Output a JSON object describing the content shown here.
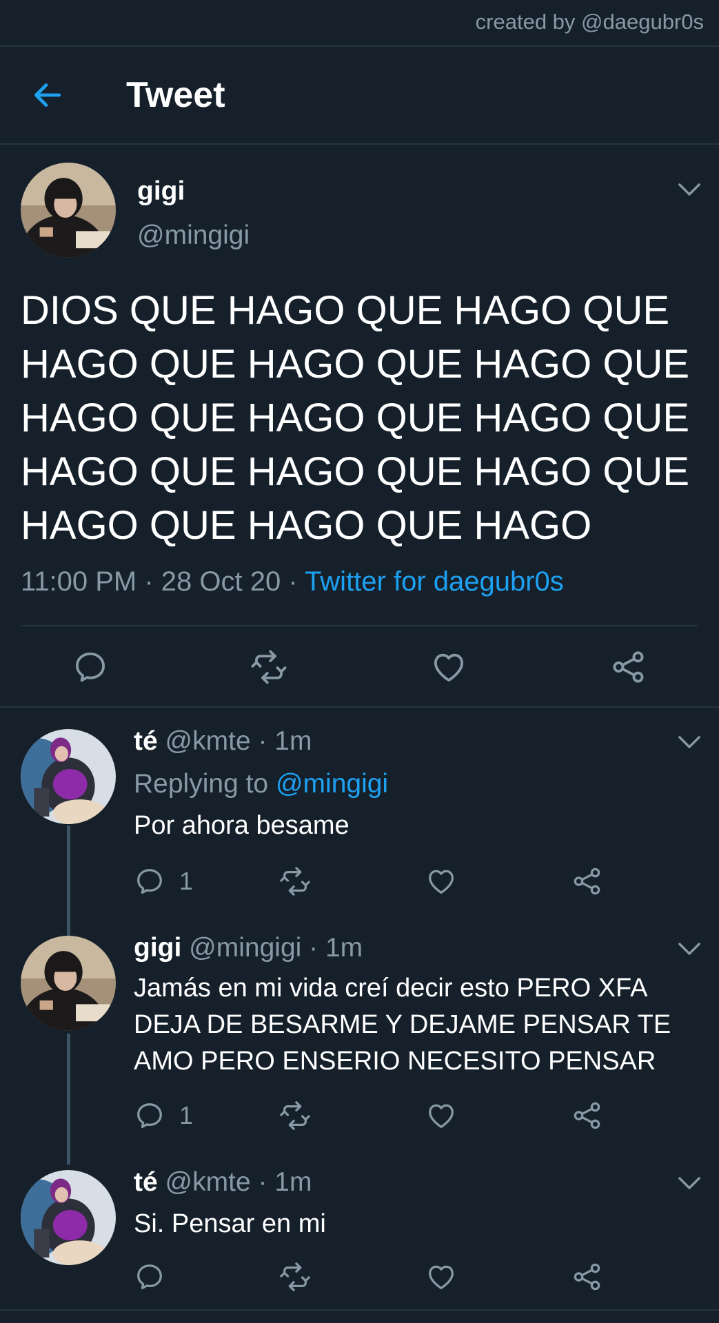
{
  "credit": "created by @daegubr0s",
  "header": {
    "title": "Tweet"
  },
  "main_tweet": {
    "name": "gigi",
    "handle": "@mingigi",
    "text": "DIOS QUE HAGO QUE HAGO QUE HAGO QUE HAGO QUE HAGO QUE HAGO QUE HAGO QUE HAGO QUE HAGO QUE HAGO QUE HAGO QUE HAGO QUE HAGO QUE HAGO",
    "time": "11:00 PM · 28 Oct 20 · ",
    "source": "Twitter for daegubr0s"
  },
  "replies": [
    {
      "name": "té",
      "handle": "@kmte · 1m",
      "replying_prefix": "Replying to ",
      "replying_to": "@mingigi",
      "text": "Por ahora besame",
      "reply_count": "1"
    },
    {
      "name": "gigi",
      "handle": "@mingigi · 1m",
      "text": "Jamás en mi vida creí decir esto PERO XFA DEJA DE BESARME Y DEJAME PENSAR TE AMO PERO ENSERIO NECESITO PENSAR",
      "reply_count": "1"
    },
    {
      "name": "té",
      "handle": "@kmte · 1m",
      "text": "Si. Pensar en mi"
    }
  ],
  "colors": {
    "background": "#15202b",
    "accent": "#1da1f2",
    "muted": "#8899a6",
    "separator": "#253341"
  },
  "icons": [
    "back-arrow-icon",
    "chevron-down-icon",
    "reply-icon",
    "retweet-icon",
    "like-icon",
    "share-icon"
  ]
}
